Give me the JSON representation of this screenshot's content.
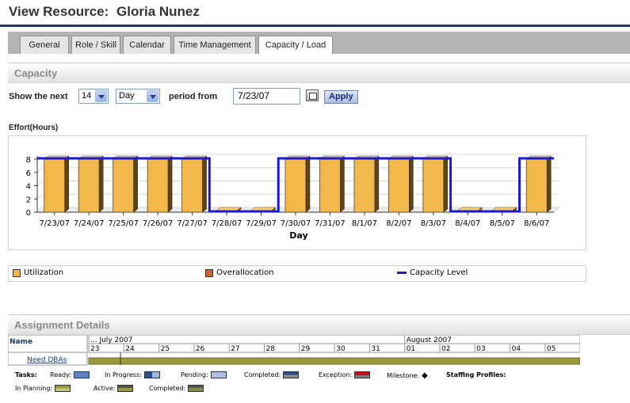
{
  "page": {
    "title": "View Resource:",
    "resource_name": "Gloria Nunez"
  },
  "tabs": [
    {
      "label": "General",
      "active": false
    },
    {
      "label": "Role / Skill",
      "active": false
    },
    {
      "label": "Calendar",
      "active": false
    },
    {
      "label": "Time Management",
      "active": false
    },
    {
      "label": "Capacity / Load",
      "active": true
    }
  ],
  "capacity": {
    "section_title": "Capacity",
    "show_label": "Show the next",
    "count_value": "14",
    "unit_value": "Day",
    "period_label": "period from",
    "date_value": "7/23/07",
    "apply_label": "Apply",
    "effort_label": "Effort(Hours)"
  },
  "chart_data": {
    "type": "bar",
    "xlabel": "Day",
    "ylabel": "Effort(Hours)",
    "ylim": [
      0,
      8
    ],
    "y_ticks": [
      "0",
      "2",
      "4",
      "6",
      "8"
    ],
    "categories": [
      "7/23/07",
      "7/24/07",
      "7/25/07",
      "7/26/07",
      "7/27/07",
      "7/28/07",
      "7/29/07",
      "7/30/07",
      "7/31/07",
      "8/1/07",
      "8/2/07",
      "8/3/07",
      "8/4/07",
      "8/5/07",
      "8/6/07"
    ],
    "series": [
      {
        "name": "Utilization",
        "values": [
          8,
          8,
          8,
          8,
          8,
          0,
          0,
          8,
          8,
          8,
          8,
          8,
          0,
          0,
          8
        ],
        "color": "#f2b84b"
      },
      {
        "name": "Overallocation",
        "values": [
          0,
          0,
          0,
          0,
          0,
          0,
          0,
          0,
          0,
          0,
          0,
          0,
          0,
          0,
          0
        ],
        "color": "#c8643c"
      },
      {
        "name": "Capacity Level",
        "values": [
          8,
          8,
          8,
          8,
          8,
          0,
          0,
          8,
          8,
          8,
          8,
          8,
          0,
          0,
          8
        ],
        "color": "#1a1ad6",
        "kind": "line"
      }
    ],
    "grid": true,
    "legend": "bottom"
  },
  "assignment": {
    "section_title": "Assignment Details",
    "name_header": "Name",
    "month_july": "... July 2007",
    "month_august": "August 2007",
    "days": [
      "23",
      "24",
      "25",
      "26",
      "27",
      "28",
      "29",
      "30",
      "31",
      "01",
      "02",
      "03",
      "04",
      "05"
    ],
    "row_name": "Need DBAs"
  },
  "task_legend": {
    "tasks_label": "Tasks:",
    "ready": "Ready:",
    "in_progress": "In Progress:",
    "pending": "Pending:",
    "completed": "Completed:",
    "exception": "Exception:",
    "milestone": "Milestone:",
    "staffing_profiles": "Staffing Profiles:",
    "in_planning": "In Planning:",
    "active": "Active:",
    "completed2": "Completed:"
  }
}
